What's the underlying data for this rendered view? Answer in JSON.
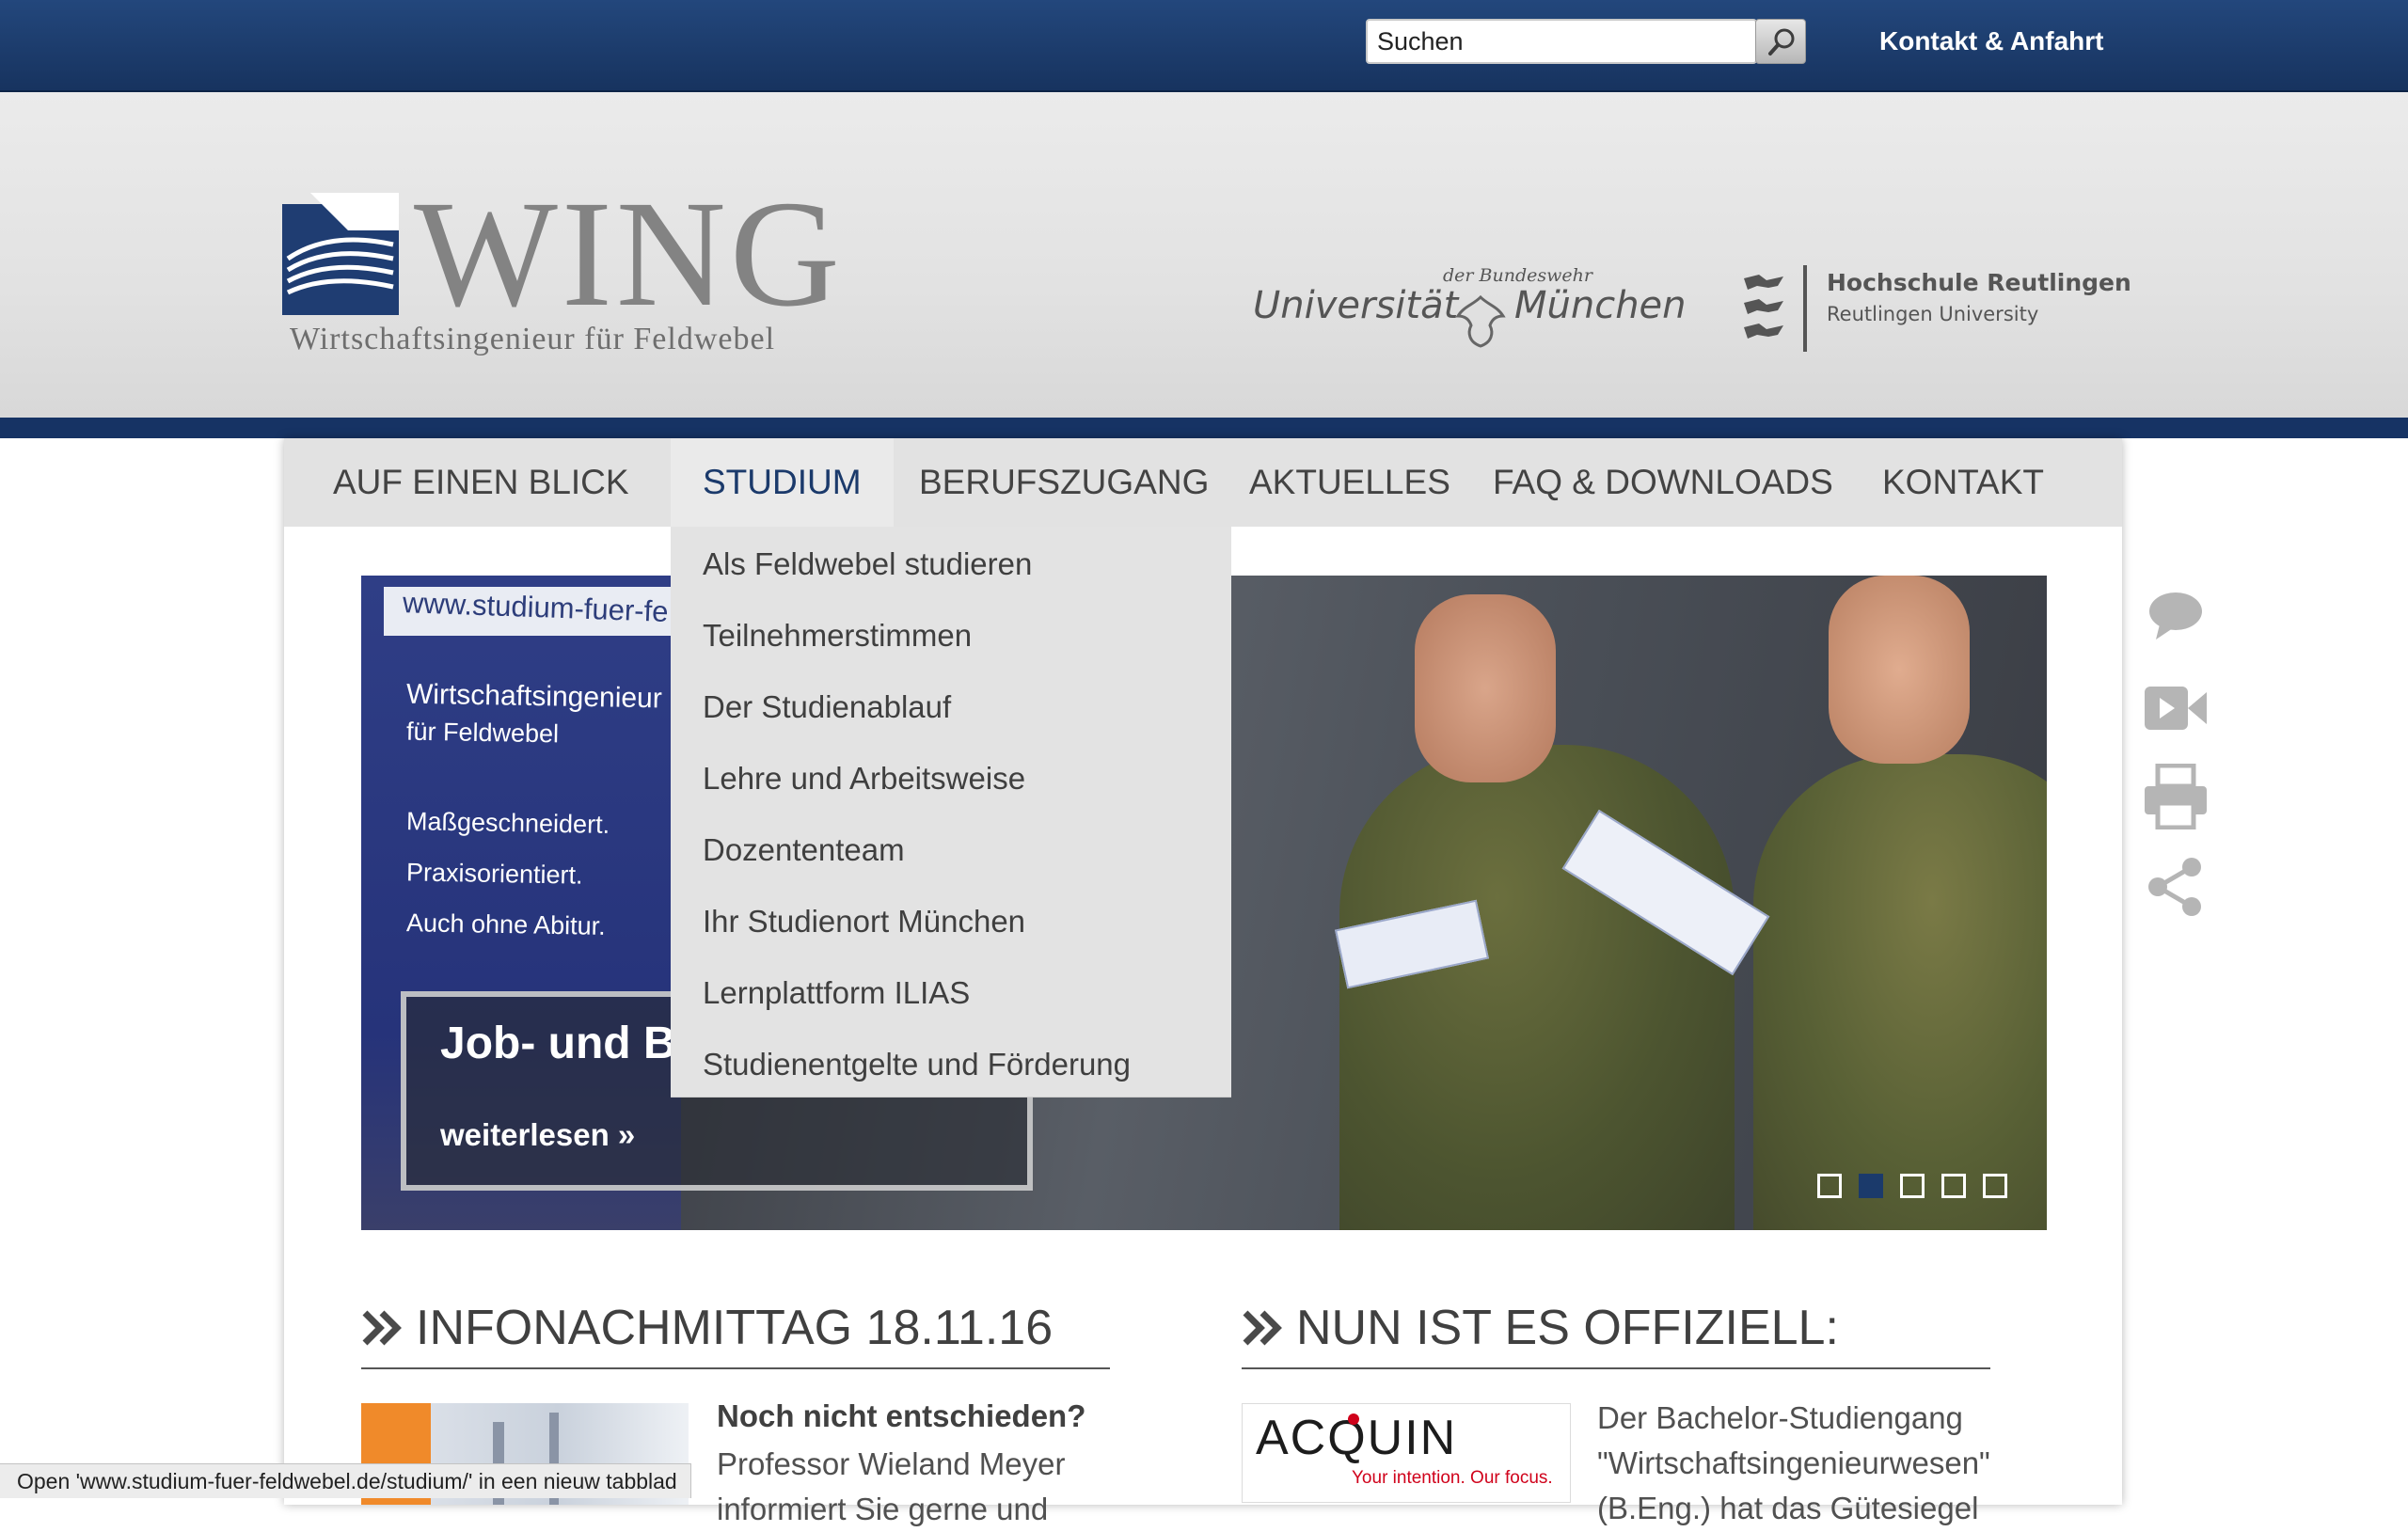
{
  "topbar": {
    "search_placeholder": "Suchen",
    "contact_label": "Kontakt & Anfahrt"
  },
  "header": {
    "logo_word": "WING",
    "logo_subtitle": "Wirtschaftsingenieur für Feldwebel",
    "unibw_small": "der Bundeswehr",
    "unibw_left": "Universität",
    "unibw_right": "München",
    "hr_name": "Hochschule Reutlingen",
    "hr_sub": "Reutlingen University"
  },
  "nav": {
    "items": [
      {
        "label": "AUF EINEN BLICK"
      },
      {
        "label": "STUDIUM"
      },
      {
        "label": "BERUFSZUGANG"
      },
      {
        "label": "AKTUELLES"
      },
      {
        "label": "FAQ & DOWNLOADS"
      },
      {
        "label": "KONTAKT"
      }
    ],
    "active": "STUDIUM"
  },
  "dropdown": {
    "items": [
      "Als Feldwebel studieren",
      "Teilnehmerstimmen",
      "Der Studienablauf",
      "Lehre und Arbeitsweise",
      "Dozententeam",
      "Ihr Studienort München",
      "Lernplattform ILIAS",
      "Studienentgelte und Förderung"
    ]
  },
  "slider": {
    "banner_url": "www.studium-fuer-fe",
    "banner_lines": [
      "Wirtschaftsingenieur",
      "für Feldwebel",
      "Maßgeschneidert.",
      "Praxisorientiert.",
      "Auch ohne Abitur."
    ],
    "caption_title": "Job- und Bi des BFD",
    "caption_more": "weiterlesen »",
    "dots_count": 5,
    "active_dot": 2
  },
  "side_tools": [
    "chat-icon",
    "video-icon",
    "print-icon",
    "share-icon"
  ],
  "news": [
    {
      "heading": "INFONACHMITTAG 18.11.16",
      "title": "Noch nicht entschieden?",
      "lines": [
        "Professor Wieland Meyer",
        "informiert Sie gerne und"
      ]
    },
    {
      "heading": "NUN IST ES OFFIZIELL:",
      "logo_text": "ACQUIN",
      "logo_tagline": "Your intention. Our focus.",
      "lines": [
        "Der Bachelor-Studiengang",
        "\"Wirtschaftsingenieurwesen\"",
        "(B.Eng.) hat das Gütesiegel"
      ]
    }
  ],
  "statusbar": {
    "text": "Open 'www.studium-fuer-feldwebel.de/studium/' in een nieuw tabblad"
  },
  "colors": {
    "topbar": "#1c3c6c",
    "stripe": "#163364",
    "accent": "#1b3a6b",
    "nav_bg": "#e2e2e2"
  }
}
